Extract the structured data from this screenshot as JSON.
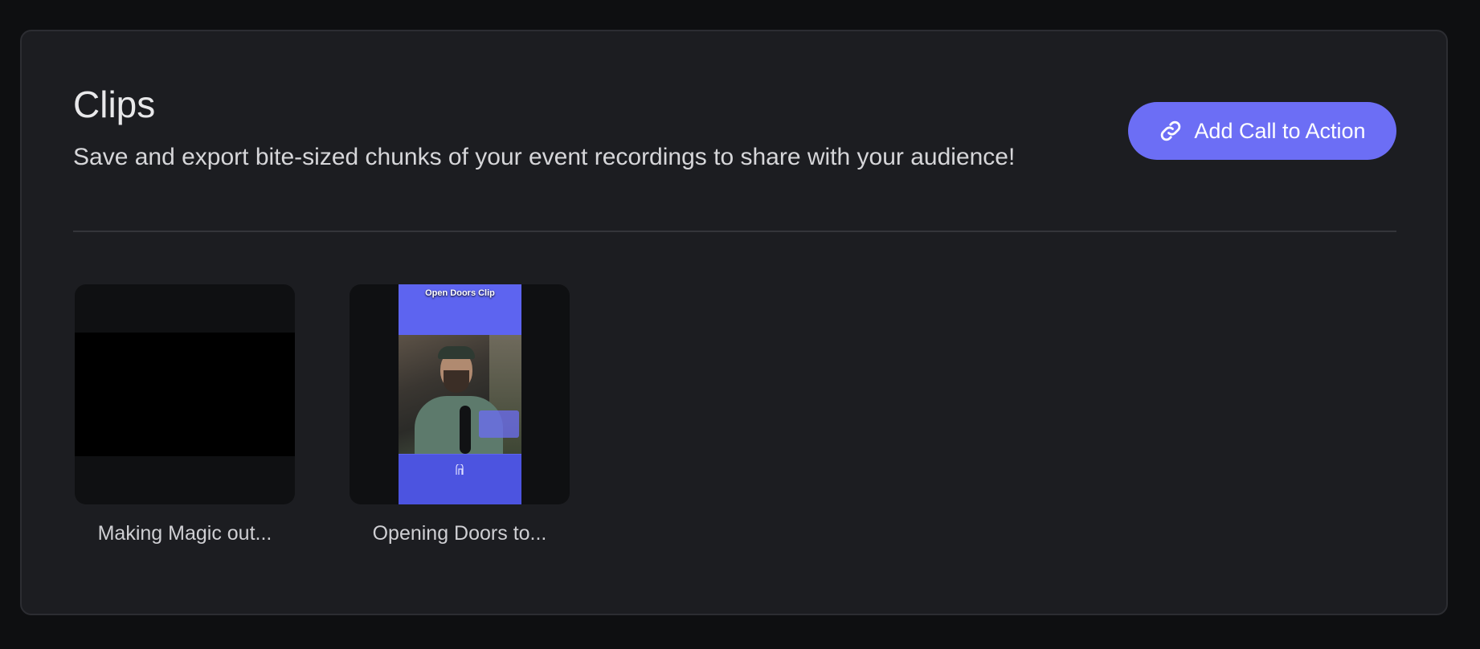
{
  "header": {
    "title": "Clips",
    "subtitle": "Save and export bite-sized chunks of your event recordings to share with your audience!",
    "cta_label": "Add Call to Action",
    "cta_icon": "link-icon"
  },
  "colors": {
    "background": "#0e0f11",
    "panel": "#1c1d21",
    "accent": "#6c6ef5",
    "divider": "#34353a"
  },
  "clips": [
    {
      "label": "Making Magic out..."
    },
    {
      "label": "Opening Doors to...",
      "thumbnail_title": "Open Doors Clip",
      "thumbnail_icon": "door-icon"
    }
  ]
}
